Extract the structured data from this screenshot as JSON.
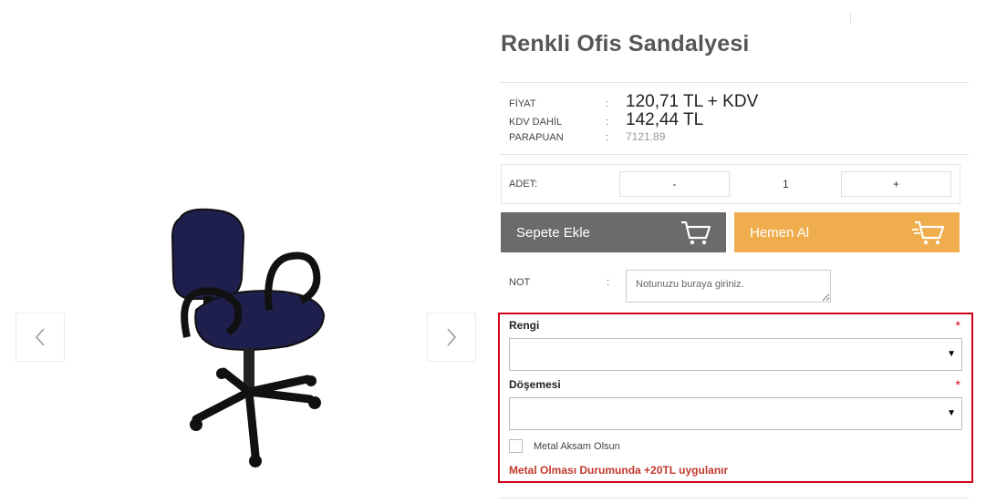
{
  "product": {
    "title": "Renkli Ofis Sandalyesi"
  },
  "prices": [
    {
      "label": "FİYAT",
      "value": "120,71 TL + KDV"
    },
    {
      "label": "KDV DAHİL",
      "value": "142,44 TL"
    },
    {
      "label": "PARAPUAN",
      "value": "7121.89"
    }
  ],
  "quantity": {
    "label": "ADET:",
    "minus": "-",
    "value": "1",
    "plus": "+"
  },
  "buttons": {
    "add_to_cart": "Sepete Ekle",
    "buy_now": "Hemen Al"
  },
  "note": {
    "label": "NOT",
    "colon": ":",
    "placeholder": "Notunuzu buraya giriniz."
  },
  "options": {
    "color_label": "Rengi",
    "upholstery_label": "Döşemesi",
    "required_mark": "*",
    "metal_label": "Metal Aksam Olsun",
    "warning": "Metal Olması Durumunda +20TL uygulanır"
  },
  "colors": {
    "add_button": "#6b6b6b",
    "buy_button": "#f0ad4e",
    "required": "#d0021b",
    "warning": "#c0392b"
  }
}
